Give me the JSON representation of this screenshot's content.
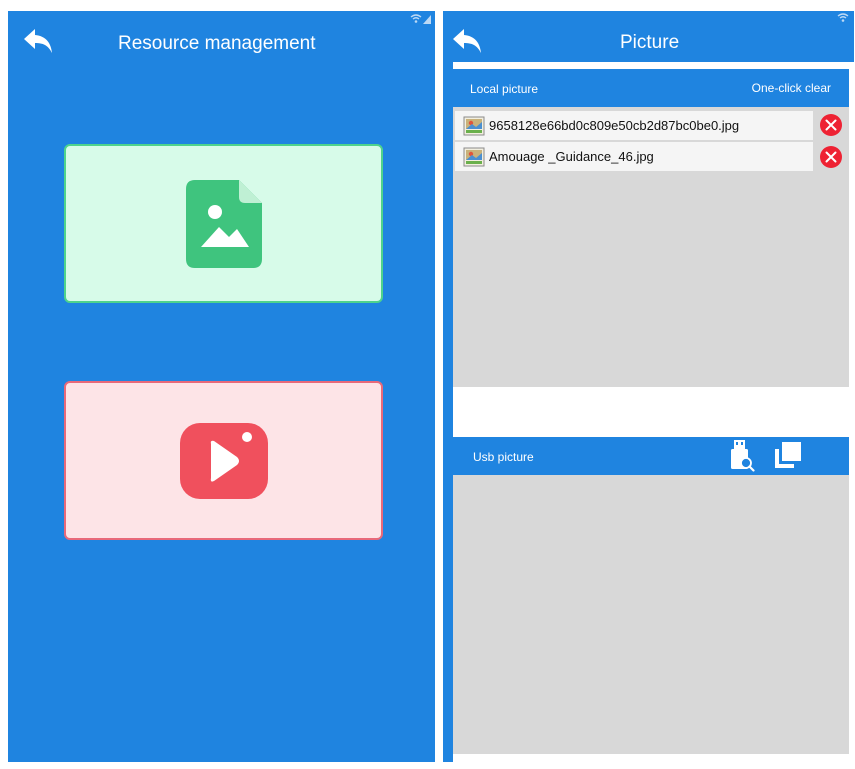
{
  "resource_screen": {
    "title": "Resource management",
    "cards": [
      {
        "name": "picture-card",
        "icon": "image-file-icon",
        "background": "#d7fbe9",
        "border": "#4ed38c"
      },
      {
        "name": "video-card",
        "icon": "video-play-icon",
        "background": "#fde4e7",
        "border": "#e8697a"
      }
    ]
  },
  "picture_screen": {
    "title": "Picture",
    "local": {
      "label": "Local picture",
      "clear_label": "One-click clear",
      "files": [
        "9658128e66bd0c809e50cb2d87bc0be0.jpg",
        "Amouage _Guidance_46.jpg"
      ]
    },
    "usb": {
      "label": "Usb picture",
      "icons": [
        "usb-search-icon",
        "copy-icon"
      ]
    }
  },
  "colors": {
    "primary": "#1f84e0",
    "list_bg": "#d8d8d8",
    "delete": "#ee2233"
  }
}
